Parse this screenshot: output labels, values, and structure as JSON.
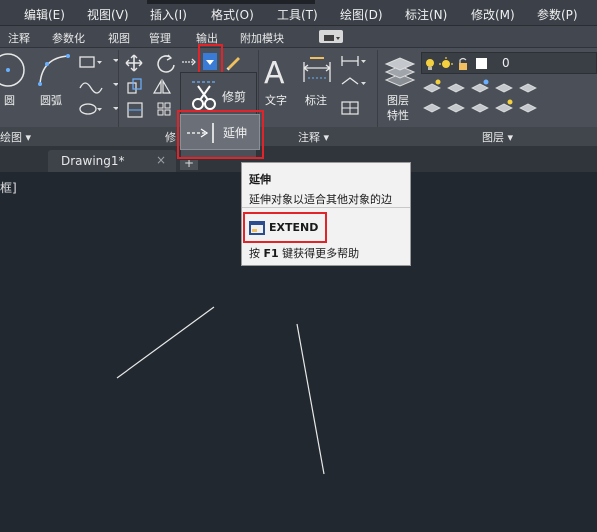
{
  "menu": {
    "items": [
      "编辑(E)",
      "视图(V)",
      "插入(I)",
      "格式(O)",
      "工具(T)",
      "绘图(D)",
      "标注(N)",
      "修改(M)",
      "参数(P)"
    ]
  },
  "ribbon_tabs": [
    "注释",
    "参数化",
    "视图",
    "管理",
    "输出",
    "附加模块"
  ],
  "ribbon": {
    "draw": {
      "circle": "圆",
      "arc": "圆弧",
      "panel_title": "绘图 ▾"
    },
    "modify": {
      "panel_title": "修"
    },
    "annotation": {
      "text": "文字",
      "dimension": "标注",
      "panel_title": "注释 ▾"
    },
    "layers": {
      "layer_props": "图层\n特性",
      "layer_props_l1": "图层",
      "layer_props_l2": "特性",
      "current_layer": "0",
      "panel_title": "图层 ▾"
    }
  },
  "dropdown": {
    "trim": "修剪",
    "extend": "延伸"
  },
  "file_tabs": {
    "drawing": "Drawing1*",
    "close": "×",
    "new": "+"
  },
  "viewport": {
    "label": "框]"
  },
  "tooltip": {
    "title": "延伸",
    "description": "延伸对象以适合其他对象的边",
    "command": "EXTEND",
    "help_prefix": "按",
    "help_key": "F1",
    "help_suffix": "键获得更多帮助"
  },
  "colors": {
    "highlight": "#e0242a",
    "canvas": "#212830",
    "ribbon": "#4b5058"
  }
}
